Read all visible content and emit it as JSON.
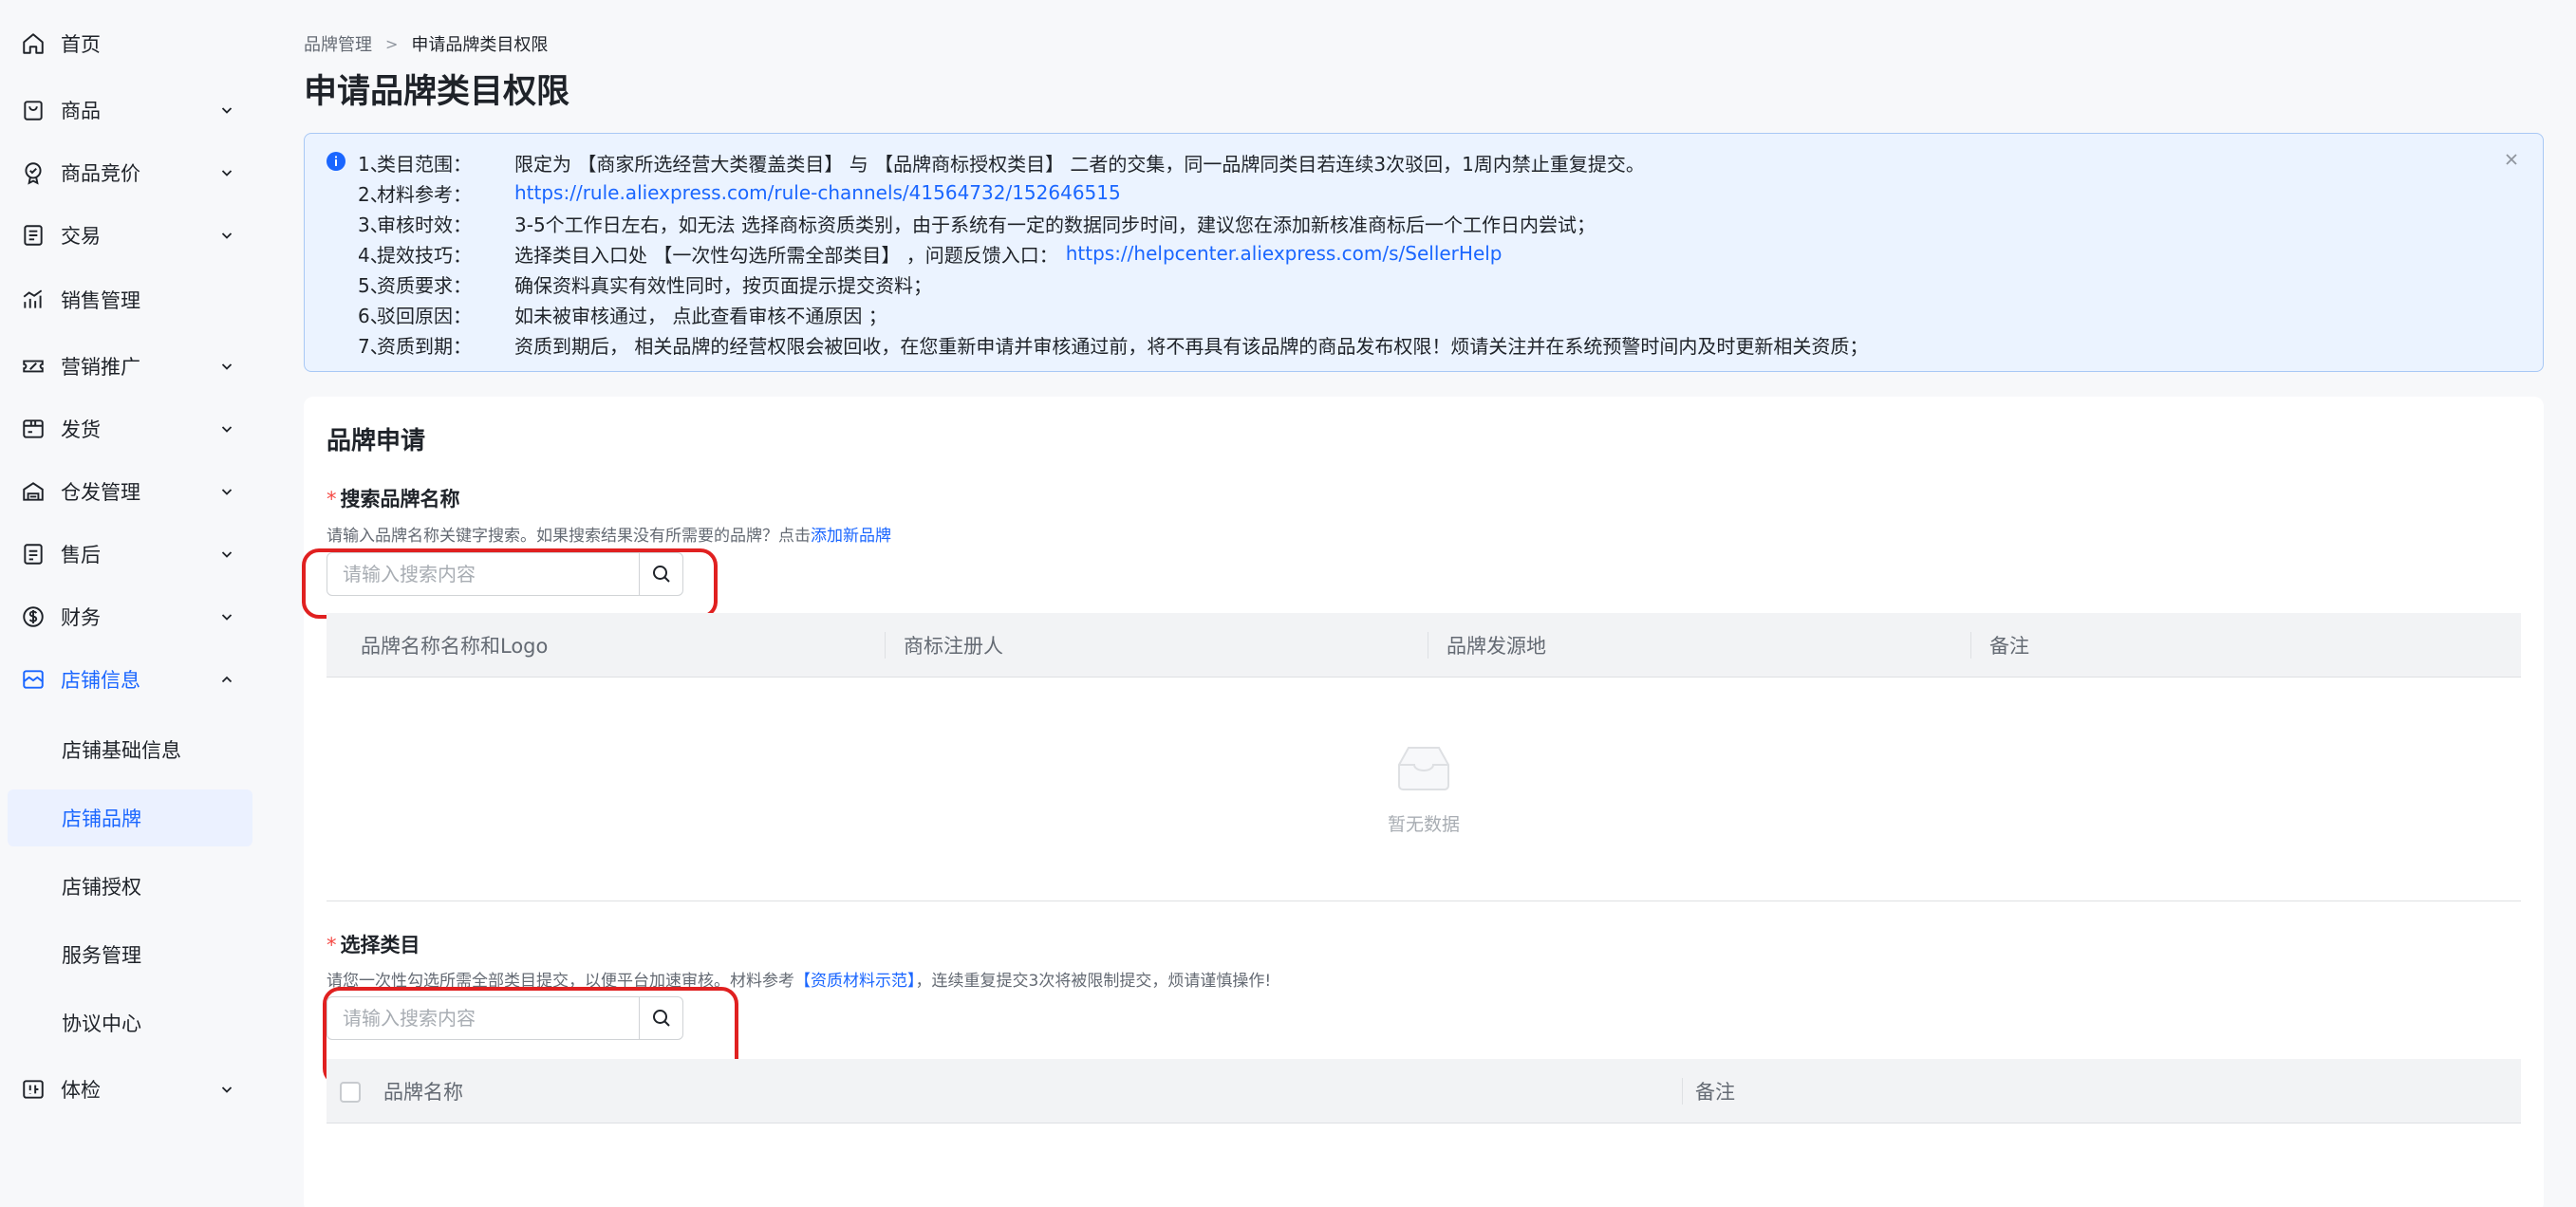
{
  "sidebar": {
    "items": [
      {
        "label": "首页",
        "icon": "home-icon",
        "has_children": false
      },
      {
        "label": "商品",
        "icon": "shopping-bag-icon",
        "has_children": true
      },
      {
        "label": "商品竞价",
        "icon": "check-badge-icon",
        "has_children": true
      },
      {
        "label": "交易",
        "icon": "clipboard-list-icon",
        "has_children": true
      },
      {
        "label": "销售管理",
        "icon": "bar-chart-icon",
        "has_children": false
      },
      {
        "label": "营销推广",
        "icon": "ticket-icon",
        "has_children": true
      },
      {
        "label": "发货",
        "icon": "package-icon",
        "has_children": true
      },
      {
        "label": "仓发管理",
        "icon": "warehouse-icon",
        "has_children": true
      },
      {
        "label": "售后",
        "icon": "clipboard-icon",
        "has_children": true
      },
      {
        "label": "财务",
        "icon": "dollar-circle-icon",
        "has_children": true
      },
      {
        "label": "店铺信息",
        "icon": "store-icon",
        "has_children": true,
        "expanded": true
      },
      {
        "label": "体检",
        "icon": "health-check-icon",
        "has_children": true
      }
    ],
    "sub_items": [
      {
        "label": "店铺基础信息",
        "selected": false
      },
      {
        "label": "店铺品牌",
        "selected": true
      },
      {
        "label": "店铺授权",
        "selected": false
      },
      {
        "label": "服务管理",
        "selected": false
      },
      {
        "label": "协议中心",
        "selected": false
      }
    ]
  },
  "breadcrumb": {
    "parent": "品牌管理",
    "separator": ">",
    "current": "申请品牌类目权限"
  },
  "page_title": "申请品牌类目权限",
  "notice": {
    "lines": [
      {
        "num": "1、",
        "head": "类目范围：",
        "text": "限定为 【商家所选经营大类覆盖类目】 与 【品牌商标授权类目】 二者的交集，同一品牌同类目若连续3次驳回，1周内禁止重复提交。"
      },
      {
        "num": "2、",
        "head": "材料参考：",
        "link": "https://rule.aliexpress.com/rule-channels/41564732/152646515"
      },
      {
        "num": "3、",
        "head": "审核时效：",
        "text": "3-5个工作日左右，如无法 选择商标资质类别，由于系统有一定的数据同步时间，建议您在添加新核准商标后一个工作日内尝试；"
      },
      {
        "num": "4、",
        "head": "提效技巧：",
        "text": "选择类目入口处 【一次性勾选所需全部类目】 ，问题反馈入口： ",
        "link": "https://helpcenter.aliexpress.com/s/SellerHelp"
      },
      {
        "num": "5、",
        "head": "资质要求：",
        "text": "确保资料真实有效性同时，按页面提示提交资料；"
      },
      {
        "num": "6、",
        "head": "驳回原因：",
        "text": "如未被审核通过， 点此查看审核不通原因 ；"
      },
      {
        "num": "7、",
        "head": "资质到期：",
        "text": "资质到期后， 相关品牌的经营权限会被回收，在您重新申请并审核通过前，将不再具有该品牌的商品发布权限！烦请关注并在系统预警时间内及时更新相关资质；"
      }
    ]
  },
  "brand_section": {
    "title": "品牌申请",
    "search": {
      "required_mark": "*",
      "label": "搜索品牌名称",
      "hint_prefix": "请输入品牌名称关键字搜索。如果搜索结果没有所需要的品牌？点击",
      "hint_link": "添加新品牌",
      "placeholder": "请输入搜索内容",
      "value": ""
    },
    "table": {
      "columns": [
        "品牌名称名称和Logo",
        "商标注册人",
        "品牌发源地",
        "备注"
      ],
      "empty_text": "暂无数据"
    }
  },
  "category_section": {
    "required_mark": "*",
    "label": "选择类目",
    "hint_prefix": "请您一次性勾选所需全部类目提交，以便平台加速审核。材料参考",
    "hint_link": "【资质材料示范】",
    "hint_suffix": "，连续重复提交3次将被限制提交，烦请谨慎操作!",
    "placeholder": "请输入搜索内容",
    "value": "",
    "table": {
      "columns": [
        "品牌名称",
        "备注"
      ],
      "select_all_checked": false
    }
  },
  "colors": {
    "accent": "#1a66ff",
    "highlight_border": "#e02020",
    "notice_bg": "#ebf3ff",
    "required": "#f54a45"
  }
}
